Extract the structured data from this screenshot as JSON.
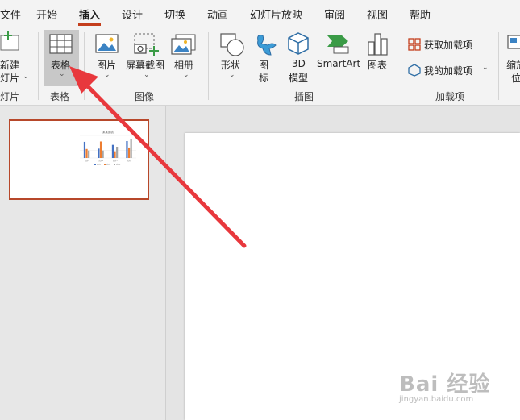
{
  "tabs": [
    "文件",
    "开始",
    "插入",
    "设计",
    "切换",
    "动画",
    "幻灯片放映",
    "审阅",
    "视图",
    "帮助"
  ],
  "active_tab": "插入",
  "ribbon": {
    "new_slide": {
      "line1": "新建",
      "line2": "灯片"
    },
    "new_slide_group": "灯片",
    "table_button": "表格",
    "table_group": "表格",
    "images": {
      "picture": "图片",
      "screenshot": "屏幕截图",
      "album": "相册",
      "group": "图像"
    },
    "illustrations": {
      "shapes": "形状",
      "icons": "图标",
      "model3d_line1": "3D",
      "model3d_line2": "模型",
      "smartart": "SmartArt",
      "chart": "图表",
      "group": "插图"
    },
    "addins": {
      "get": "获取加载项",
      "my": "我的加载项",
      "group": "加载项"
    },
    "zoom": {
      "line1": "缩放",
      "line2": "位"
    }
  },
  "thumbnail": {
    "title": "某某图表",
    "categories": [
      "类别1",
      "类别2",
      "类别3",
      "类别4"
    ],
    "series": [
      {
        "color": "#4472c4",
        "values": [
          4.3,
          2.5,
          3.5,
          4.5
        ]
      },
      {
        "color": "#ed7d31",
        "values": [
          2.4,
          4.4,
          1.8,
          2.8
        ]
      },
      {
        "color": "#a5a5a5",
        "values": [
          2,
          2,
          3,
          5
        ]
      }
    ],
    "legend": [
      "系列1",
      "系列2",
      "系列3"
    ],
    "ymax": 6
  },
  "annotation_arrow_color": "#e8383d",
  "watermark": {
    "main": "Bai 经验",
    "sub": "jingyan.baidu.com"
  }
}
